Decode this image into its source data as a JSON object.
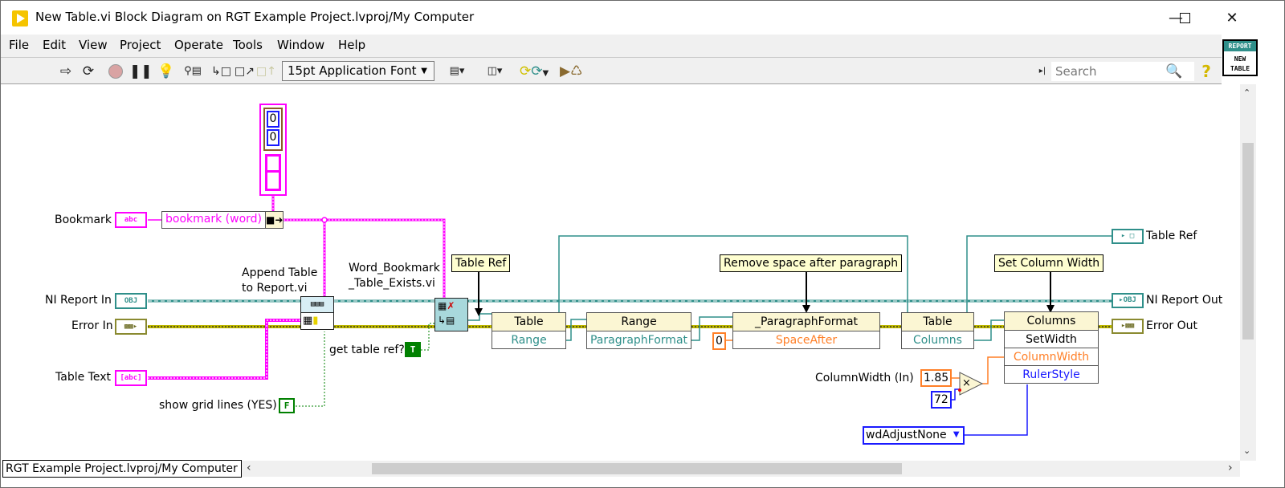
{
  "window": {
    "title": "New Table.vi Block Diagram on RGT Example Project.lvproj/My Computer",
    "controls": [
      "minimize",
      "maximize",
      "close"
    ]
  },
  "menu": [
    "File",
    "Edit",
    "View",
    "Project",
    "Operate",
    "Tools",
    "Window",
    "Help"
  ],
  "toolbar": {
    "icons": [
      "run-icon",
      "run-continuously-icon",
      "abort-icon",
      "pause-icon",
      "highlight-execution-icon",
      "retain-wire-values-icon",
      "step-into-icon",
      "step-over-icon",
      "step-out-icon",
      "align-objects-icon",
      "distribute-objects-icon",
      "reorder-icon",
      "clean-up-diagram-icon"
    ],
    "font_select": "15pt Application Font",
    "search_placeholder": "Search"
  },
  "vi_icon": {
    "top": "REPORT",
    "line1": "NEW",
    "line2": "TABLE"
  },
  "diagram": {
    "controls": {
      "bookmark": "Bookmark",
      "ni_report_in": "NI Report In",
      "error_in": "Error In",
      "table_text": "Table Text",
      "show_grid_lines": "show grid lines (YES)",
      "get_table_ref": "get table ref?",
      "column_width": "ColumnWidth (In)"
    },
    "terminal_glyphs": {
      "string": "abc",
      "string_array": "[abc]",
      "obj": "OBJ",
      "bool_false": "F",
      "bool_true": "T"
    },
    "indicators": {
      "table_ref": "Table Ref",
      "ni_report_out": "NI Report Out",
      "error_out": "Error Out"
    },
    "array_const_values": [
      "0",
      "0"
    ],
    "bundle_label": "bookmark (word)",
    "subvis": {
      "append_table": "Append Table\nto Report.vi",
      "append_table_l1": "Append Table",
      "append_table_l2": "to Report.vi",
      "bookmark_exists_l1": "Word_Bookmark",
      "bookmark_exists_l2": "_Table_Exists.vi"
    },
    "property_nodes": [
      {
        "class": "Table",
        "property": "Range"
      },
      {
        "class": "Range",
        "property": "ParagraphFormat"
      },
      {
        "class": "_ParagraphFormat",
        "property": "SpaceAfter"
      },
      {
        "class": "Table",
        "property": "Columns"
      }
    ],
    "invoke_node": {
      "class": "Columns",
      "method": "SetWidth",
      "params": [
        "ColumnWidth",
        "RulerStyle"
      ]
    },
    "constants": {
      "space_after": "0",
      "column_width": "1.85",
      "points_per_inch": "72",
      "ruler_style": "wdAdjustNone"
    },
    "multiply_glyph": "×",
    "comments": [
      "Table Ref",
      "Remove space after paragraph",
      "Set Column Width"
    ]
  },
  "status_bar": {
    "context": "RGT Example Project.lvproj/My Computer"
  },
  "colors": {
    "refnum_wire": "#2f8f8a",
    "error_wire": "#cfcf00",
    "string_wire": "#ff00ff",
    "bool_wire": "#008000",
    "double_wire": "#ff7f27",
    "int_wire": "#1a1aff",
    "property_header": "#fbf6d3"
  }
}
